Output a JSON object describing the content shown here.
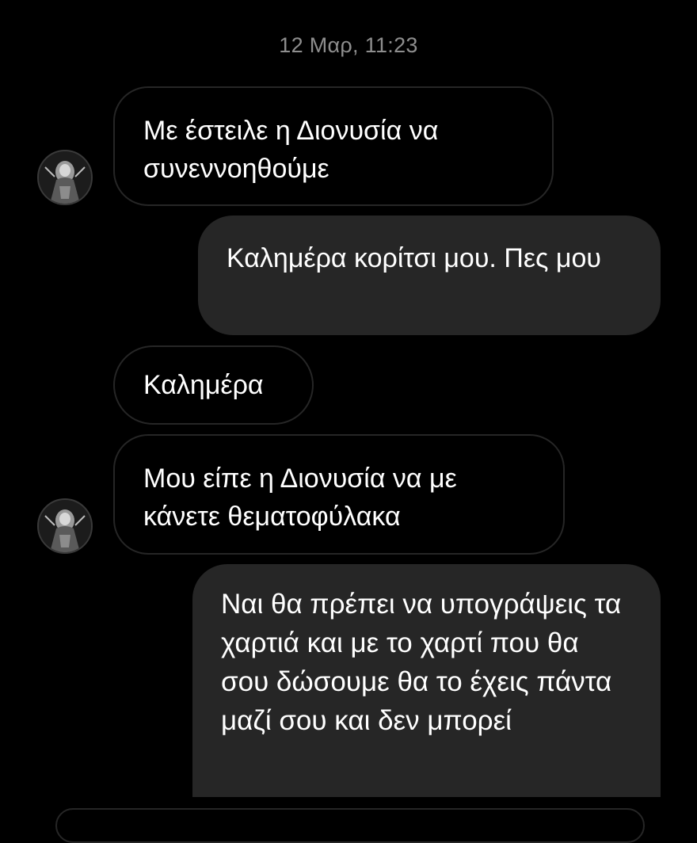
{
  "conversation": {
    "timestamp": "12 Μαρ, 11:23",
    "messages": [
      {
        "direction": "incoming",
        "text": "Με έστειλε η Διονυσία να συνεννοηθούμε"
      },
      {
        "direction": "outgoing",
        "text": "Καλημέρα κορίτσι μου. Πες μου"
      },
      {
        "direction": "incoming",
        "text": "Καλημέρα"
      },
      {
        "direction": "incoming",
        "text": "Μου είπε η Διονυσία να με κάνετε θεματοφύλακα"
      },
      {
        "direction": "outgoing",
        "text": "Ναι θα πρέπει να υπογράψεις τα χαρτιά και με το χαρτί που θα σου δώσουμε θα το έχεις πάντα μαζί σου και δεν μπορεί"
      }
    ]
  },
  "colors": {
    "background": "#000000",
    "incoming_border": "#262626",
    "outgoing_fill": "#262626",
    "timestamp_text": "#8e8e8e",
    "message_text": "#ffffff"
  },
  "icons": {
    "avatar": "contact-avatar"
  }
}
